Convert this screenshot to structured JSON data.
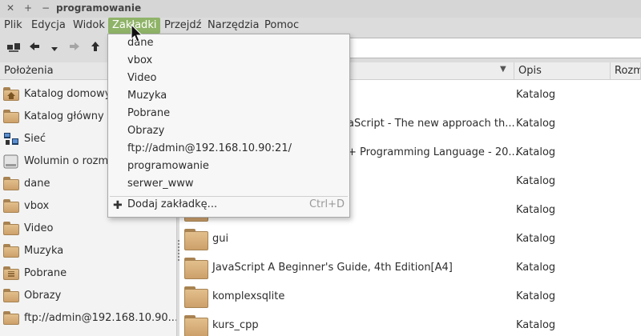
{
  "window": {
    "close_glyph": "✕",
    "plus_glyph": "+",
    "minimize_glyph": "−",
    "title": "programowanie"
  },
  "menubar": {
    "items": [
      "Plik",
      "Edycja",
      "Widok",
      "Zakładki",
      "Przejdź",
      "Narzędzia",
      "Pomoc"
    ],
    "active": "Zakładki"
  },
  "toolbar": {
    "icons": [
      "network-folder-icon",
      "back-arrow-icon",
      "dropdown-arrow-icon",
      "forward-arrow-icon",
      "up-arrow-icon"
    ]
  },
  "sidebar": {
    "header": "Położenia",
    "items": [
      {
        "label": "Katalog domowy",
        "icon": "home-folder-icon"
      },
      {
        "label": "Katalog główny s",
        "icon": "folder-icon"
      },
      {
        "label": "Sieć",
        "icon": "network-icon"
      },
      {
        "label": "Wolumin o rozmia",
        "icon": "drive-icon"
      },
      {
        "label": "dane",
        "icon": "folder-icon"
      },
      {
        "label": "vbox",
        "icon": "folder-icon"
      },
      {
        "label": "Video",
        "icon": "folder-icon"
      },
      {
        "label": "Muzyka",
        "icon": "folder-icon"
      },
      {
        "label": "Pobrane",
        "icon": "download-folder-icon"
      },
      {
        "label": "Obrazy",
        "icon": "folder-icon"
      },
      {
        "label": "ftp://admin@192.168.10.90...",
        "icon": "folder-icon"
      }
    ]
  },
  "content": {
    "columns": [
      "",
      "Opis",
      "Rozmi"
    ],
    "rows": [
      {
        "name": "",
        "type": "Katalog"
      },
      {
        "name": "aScript - The new approach th...",
        "type": "Katalog"
      },
      {
        "name": "+ Programming Language - 20...",
        "type": "Katalog"
      },
      {
        "name": "",
        "type": "Katalog"
      },
      {
        "name": "",
        "type": "Katalog"
      },
      {
        "name": "gui",
        "type": "Katalog"
      },
      {
        "name": "JavaScript A Beginner's Guide, 4th Edition[A4]",
        "type": "Katalog"
      },
      {
        "name": "komplexsqlite",
        "type": "Katalog"
      },
      {
        "name": "kurs_cpp",
        "type": "Katalog"
      }
    ]
  },
  "bookmarks_menu": {
    "items": [
      "dane",
      "vbox",
      "Video",
      "Muzyka",
      "Pobrane",
      "Obrazy",
      "ftp://admin@192.168.10.90:21/",
      "programowanie",
      "serwer_www"
    ],
    "add_label": "Dodaj zakładkę...",
    "add_shortcut": "Ctrl+D"
  },
  "colors": {
    "accent": "#8fb368",
    "folder": "#d8b07c"
  }
}
